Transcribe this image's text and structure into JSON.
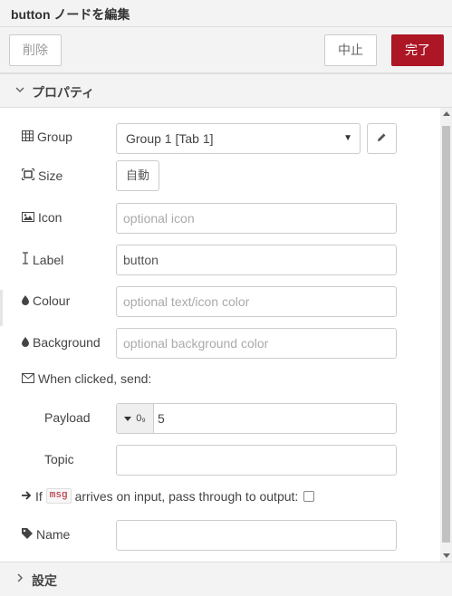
{
  "tray": {
    "title": "button ノードを編集"
  },
  "toolbar": {
    "delete_label": "削除",
    "cancel_label": "中止",
    "done_label": "完了"
  },
  "sections": {
    "properties_label": "プロパティ",
    "settings_label": "設定"
  },
  "form": {
    "group": {
      "label": "Group",
      "value": "Group 1 [Tab 1]"
    },
    "size": {
      "label": "Size",
      "value": "自動"
    },
    "icon": {
      "label": "Icon",
      "placeholder": "optional icon"
    },
    "label": {
      "label": "Label",
      "value": "button"
    },
    "colour": {
      "label": "Colour",
      "placeholder": "optional text/icon color"
    },
    "background": {
      "label": "Background",
      "placeholder": "optional background color"
    },
    "when_clicked": "When clicked, send:",
    "payload": {
      "label": "Payload",
      "type_glyph": "0₉",
      "value": "5"
    },
    "topic": {
      "label": "Topic",
      "value": ""
    },
    "passthrough": {
      "prefix": "If",
      "code": "msg",
      "suffix": "arrives on input, pass through to output:",
      "checked": false
    },
    "name": {
      "label": "Name",
      "value": ""
    }
  },
  "colors": {
    "accent": "#ad1625",
    "header_bg": "#f3f3f3"
  }
}
